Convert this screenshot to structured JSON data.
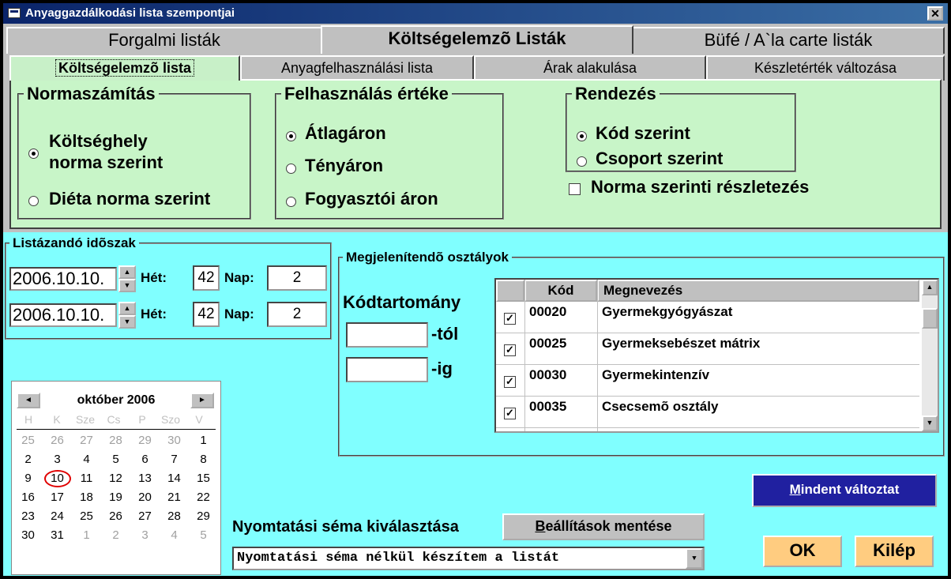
{
  "window": {
    "title": "Anyaggazdálkodási lista szempontjai",
    "close_glyph": "✕"
  },
  "main_tabs": [
    {
      "label": "Forgalmi listák"
    },
    {
      "label": "Költségelemzõ Listák"
    },
    {
      "label": "Büfé / A`la carte listák"
    }
  ],
  "sub_tabs": [
    {
      "label": "Költségelemzõ lista"
    },
    {
      "label": "Anyagfelhasználási lista"
    },
    {
      "label": "Árak alakulása"
    },
    {
      "label": "Készletérték változása"
    }
  ],
  "normaszamitas": {
    "title": "Normaszámítás",
    "opt1_line1": "Költséghely",
    "opt1_line2": "norma szerint",
    "opt2": "Diéta norma szerint",
    "selected": 1
  },
  "felhasznalas": {
    "title": "Felhasználás értéke",
    "options": [
      "Átlagáron",
      "Tényáron",
      "Fogyasztói áron"
    ],
    "selected": 1
  },
  "rendezes": {
    "title": "Rendezés",
    "options": [
      "Kód szerint",
      "Csoport szerint"
    ],
    "selected": 1
  },
  "norma_reszletezes": {
    "label": "Norma szerinti részletezés",
    "checked": false
  },
  "idoszak": {
    "title": "Listázandó idõszak",
    "het_label": "Hét:",
    "nap_label": "Nap:",
    "from": {
      "date": "2006.10.10.",
      "het": "42",
      "nap": "2"
    },
    "to": {
      "date": "2006.10.10.",
      "het": "42",
      "nap": "2"
    }
  },
  "calendar": {
    "title": "október 2006",
    "prev": "◄",
    "next": "►",
    "dow": [
      "H",
      "K",
      "Sze",
      "Cs",
      "P",
      "Szo",
      "V"
    ],
    "weeks": [
      [
        "25",
        "26",
        "27",
        "28",
        "29",
        "30",
        "1"
      ],
      [
        "2",
        "3",
        "4",
        "5",
        "6",
        "7",
        "8"
      ],
      [
        "9",
        "10",
        "11",
        "12",
        "13",
        "14",
        "15"
      ],
      [
        "16",
        "17",
        "18",
        "19",
        "20",
        "21",
        "22"
      ],
      [
        "23",
        "24",
        "25",
        "26",
        "27",
        "28",
        "29"
      ],
      [
        "30",
        "31",
        "1",
        "2",
        "3",
        "4",
        "5"
      ]
    ],
    "today": "10"
  },
  "osztalyok": {
    "title": "Megjelenítendõ osztályok",
    "kodtartomany": "Kódtartomány",
    "tol": "-tól",
    "ig": "-ig",
    "columns": {
      "kod": "Kód",
      "megnevezes": "Megnevezés"
    },
    "rows": [
      {
        "kod": "00020",
        "name": "Gyermekgyógyászat",
        "checked": true
      },
      {
        "kod": "00025",
        "name": "Gyermeksebészet mátrix",
        "checked": true
      },
      {
        "kod": "00030",
        "name": "Gyermekintenzív",
        "checked": true
      },
      {
        "kod": "00035",
        "name": "Csecsemõ osztály",
        "checked": true
      }
    ]
  },
  "buttons": {
    "mindent_ul": "M",
    "mindent_rest": "indent változtat",
    "beallitasok_ul": "B",
    "beallitasok_rest": "eállítások mentése",
    "ok": "OK",
    "kilep": "Kilép"
  },
  "nyomtatasi": {
    "label": "Nyomtatási séma kiválasztása",
    "value": "Nyomtatási séma nélkül készítem a listát"
  },
  "colors": {
    "green_panel": "#c8f5c8",
    "cyan_area": "#80ffff",
    "accent_button": "#2020a0",
    "ok_button": "#ffcc80"
  }
}
